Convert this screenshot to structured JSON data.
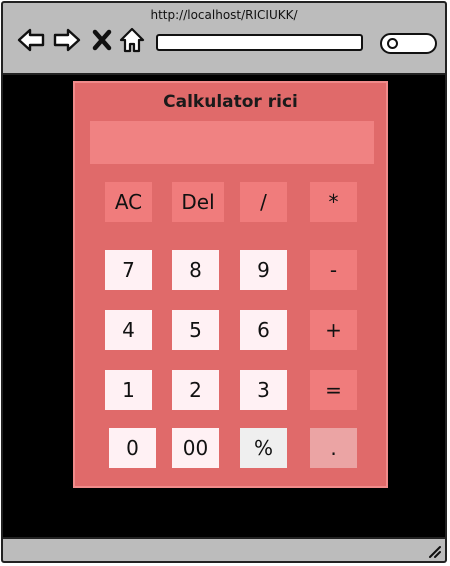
{
  "browser": {
    "url": "http://localhost/RICIUKK/",
    "address_value": "",
    "icons": {
      "back": "arrow-left-icon",
      "forward": "arrow-right-icon",
      "stop": "close-icon",
      "home": "home-icon",
      "search": "search-icon",
      "resize": "resize-grip-icon"
    }
  },
  "calculator": {
    "title": "Calkulator rici",
    "display_value": "",
    "keys": {
      "ac": "AC",
      "del": "Del",
      "divide": "/",
      "multiply": "*",
      "seven": "7",
      "eight": "8",
      "nine": "9",
      "minus": "-",
      "four": "4",
      "five": "5",
      "six": "6",
      "plus": "+",
      "one": "1",
      "two": "2",
      "three": "3",
      "equals": "=",
      "zero": "0",
      "double_zero": "00",
      "percent": "%",
      "dot": "."
    },
    "colors": {
      "panel": "#e06a6a",
      "display": "#f08282",
      "operator_key": "#f07c7c",
      "number_key": "#fff1f4"
    }
  }
}
